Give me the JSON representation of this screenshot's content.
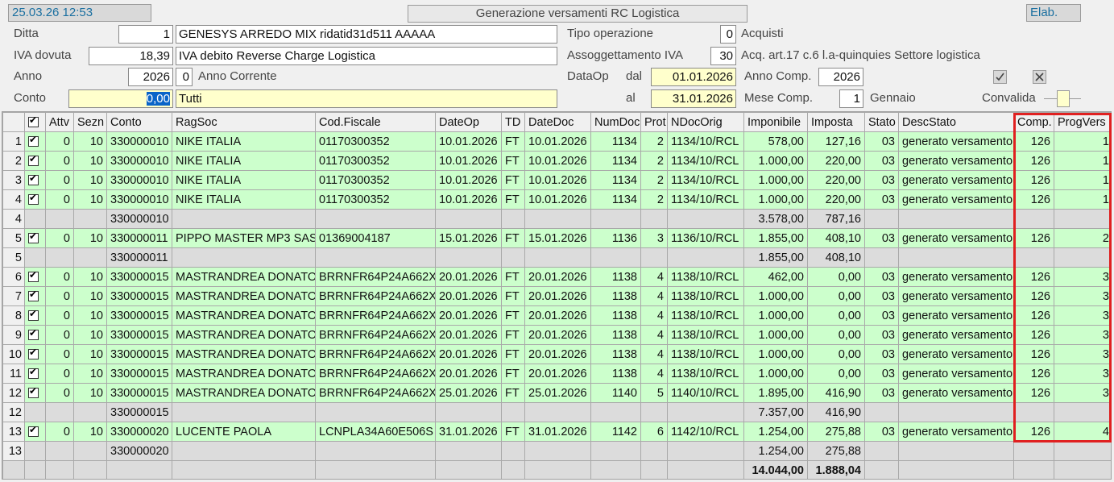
{
  "header": {
    "datetime": "25.03.26 12:53",
    "title": "Generazione versamenti RC Logistica",
    "elab_label": "Elab."
  },
  "form": {
    "ditta": {
      "label": "Ditta",
      "code": "1",
      "desc": "GENESYS ARREDO MIX ridatid31d511 AAAAA"
    },
    "iva_dovuta": {
      "label": "IVA dovuta",
      "value": "18,39",
      "desc": "IVA debito Reverse Charge Logistica"
    },
    "anno": {
      "label": "Anno",
      "value": "2026",
      "flag": "0",
      "desc": "Anno Corrente"
    },
    "conto": {
      "label": "Conto",
      "value": "0,00",
      "desc": "Tutti"
    },
    "tipo_operazione": {
      "label": "Tipo operazione",
      "value": "0",
      "desc": "Acquisti"
    },
    "assoggettamento": {
      "label": "Assoggettamento IVA",
      "value": "30",
      "desc": "Acq. art.17 c.6 l.a-quinquies Settore logistica"
    },
    "dataop": {
      "label": "DataOp",
      "dal_label": "dal",
      "dal": "01.01.2026",
      "al_label": "al",
      "al": "31.01.2026"
    },
    "anno_comp": {
      "label": "Anno Comp.",
      "value": "2026"
    },
    "mese_comp": {
      "label": "Mese Comp.",
      "value": "1",
      "desc": "Gennaio"
    },
    "convalida": {
      "label": "Convalida"
    }
  },
  "table": {
    "columns": [
      "Attv",
      "Sezn",
      "Conto",
      "RagSoc",
      "Cod.Fiscale",
      "DateOp",
      "TD",
      "DateDoc",
      "NumDoc",
      "Prot",
      "NDocOrig",
      "Imponibile",
      "Imposta",
      "Stato",
      "DescStato",
      "Comp.",
      "ProgVers"
    ],
    "rows": [
      {
        "type": "data",
        "rn": "1",
        "attv": "0",
        "sezn": "10",
        "conto": "330000010",
        "ragsoc": "NIKE ITALIA",
        "cf": "01170300352",
        "dateop": "10.01.2026",
        "td": "FT",
        "datedoc": "10.01.2026",
        "numdoc": "1134",
        "prot": "2",
        "ndoc": "1134/10/RCL",
        "imp": "578,00",
        "iva": "127,16",
        "stato": "03",
        "desc": "generato versamento",
        "comp": "126",
        "prog": "1"
      },
      {
        "type": "data",
        "rn": "2",
        "attv": "0",
        "sezn": "10",
        "conto": "330000010",
        "ragsoc": "NIKE ITALIA",
        "cf": "01170300352",
        "dateop": "10.01.2026",
        "td": "FT",
        "datedoc": "10.01.2026",
        "numdoc": "1134",
        "prot": "2",
        "ndoc": "1134/10/RCL",
        "imp": "1.000,00",
        "iva": "220,00",
        "stato": "03",
        "desc": "generato versamento",
        "comp": "126",
        "prog": "1"
      },
      {
        "type": "data",
        "rn": "3",
        "attv": "0",
        "sezn": "10",
        "conto": "330000010",
        "ragsoc": "NIKE ITALIA",
        "cf": "01170300352",
        "dateop": "10.01.2026",
        "td": "FT",
        "datedoc": "10.01.2026",
        "numdoc": "1134",
        "prot": "2",
        "ndoc": "1134/10/RCL",
        "imp": "1.000,00",
        "iva": "220,00",
        "stato": "03",
        "desc": "generato versamento",
        "comp": "126",
        "prog": "1"
      },
      {
        "type": "data",
        "rn": "4",
        "attv": "0",
        "sezn": "10",
        "conto": "330000010",
        "ragsoc": "NIKE ITALIA",
        "cf": "01170300352",
        "dateop": "10.01.2026",
        "td": "FT",
        "datedoc": "10.01.2026",
        "numdoc": "1134",
        "prot": "2",
        "ndoc": "1134/10/RCL",
        "imp": "1.000,00",
        "iva": "220,00",
        "stato": "03",
        "desc": "generato versamento",
        "comp": "126",
        "prog": "1"
      },
      {
        "type": "sub",
        "rn": "4",
        "conto": "330000010",
        "imp": "3.578,00",
        "iva": "787,16"
      },
      {
        "type": "data",
        "rn": "5",
        "attv": "0",
        "sezn": "10",
        "conto": "330000011",
        "ragsoc": "PIPPO MASTER MP3 SAS",
        "cf": "01369004187",
        "dateop": "15.01.2026",
        "td": "FT",
        "datedoc": "15.01.2026",
        "numdoc": "1136",
        "prot": "3",
        "ndoc": "1136/10/RCL",
        "imp": "1.855,00",
        "iva": "408,10",
        "stato": "03",
        "desc": "generato versamento",
        "comp": "126",
        "prog": "2"
      },
      {
        "type": "sub",
        "rn": "5",
        "conto": "330000011",
        "imp": "1.855,00",
        "iva": "408,10"
      },
      {
        "type": "data",
        "rn": "6",
        "attv": "0",
        "sezn": "10",
        "conto": "330000015",
        "ragsoc": "MASTRANDREA DONATO",
        "cf": "BRRNFR64P24A662X",
        "dateop": "20.01.2026",
        "td": "FT",
        "datedoc": "20.01.2026",
        "numdoc": "1138",
        "prot": "4",
        "ndoc": "1138/10/RCL",
        "imp": "462,00",
        "iva": "0,00",
        "stato": "03",
        "desc": "generato versamento",
        "comp": "126",
        "prog": "3"
      },
      {
        "type": "data",
        "rn": "7",
        "attv": "0",
        "sezn": "10",
        "conto": "330000015",
        "ragsoc": "MASTRANDREA DONATO",
        "cf": "BRRNFR64P24A662X",
        "dateop": "20.01.2026",
        "td": "FT",
        "datedoc": "20.01.2026",
        "numdoc": "1138",
        "prot": "4",
        "ndoc": "1138/10/RCL",
        "imp": "1.000,00",
        "iva": "0,00",
        "stato": "03",
        "desc": "generato versamento",
        "comp": "126",
        "prog": "3"
      },
      {
        "type": "data",
        "rn": "8",
        "attv": "0",
        "sezn": "10",
        "conto": "330000015",
        "ragsoc": "MASTRANDREA DONATO",
        "cf": "BRRNFR64P24A662X",
        "dateop": "20.01.2026",
        "td": "FT",
        "datedoc": "20.01.2026",
        "numdoc": "1138",
        "prot": "4",
        "ndoc": "1138/10/RCL",
        "imp": "1.000,00",
        "iva": "0,00",
        "stato": "03",
        "desc": "generato versamento",
        "comp": "126",
        "prog": "3"
      },
      {
        "type": "data",
        "rn": "9",
        "attv": "0",
        "sezn": "10",
        "conto": "330000015",
        "ragsoc": "MASTRANDREA DONATO",
        "cf": "BRRNFR64P24A662X",
        "dateop": "20.01.2026",
        "td": "FT",
        "datedoc": "20.01.2026",
        "numdoc": "1138",
        "prot": "4",
        "ndoc": "1138/10/RCL",
        "imp": "1.000,00",
        "iva": "0,00",
        "stato": "03",
        "desc": "generato versamento",
        "comp": "126",
        "prog": "3"
      },
      {
        "type": "data",
        "rn": "10",
        "attv": "0",
        "sezn": "10",
        "conto": "330000015",
        "ragsoc": "MASTRANDREA DONATO",
        "cf": "BRRNFR64P24A662X",
        "dateop": "20.01.2026",
        "td": "FT",
        "datedoc": "20.01.2026",
        "numdoc": "1138",
        "prot": "4",
        "ndoc": "1138/10/RCL",
        "imp": "1.000,00",
        "iva": "0,00",
        "stato": "03",
        "desc": "generato versamento",
        "comp": "126",
        "prog": "3"
      },
      {
        "type": "data",
        "rn": "11",
        "attv": "0",
        "sezn": "10",
        "conto": "330000015",
        "ragsoc": "MASTRANDREA DONATO",
        "cf": "BRRNFR64P24A662X",
        "dateop": "20.01.2026",
        "td": "FT",
        "datedoc": "20.01.2026",
        "numdoc": "1138",
        "prot": "4",
        "ndoc": "1138/10/RCL",
        "imp": "1.000,00",
        "iva": "0,00",
        "stato": "03",
        "desc": "generato versamento",
        "comp": "126",
        "prog": "3"
      },
      {
        "type": "data",
        "rn": "12",
        "attv": "0",
        "sezn": "10",
        "conto": "330000015",
        "ragsoc": "MASTRANDREA DONATO",
        "cf": "BRRNFR64P24A662X",
        "dateop": "25.01.2026",
        "td": "FT",
        "datedoc": "25.01.2026",
        "numdoc": "1140",
        "prot": "5",
        "ndoc": "1140/10/RCL",
        "imp": "1.895,00",
        "iva": "416,90",
        "stato": "03",
        "desc": "generato versamento",
        "comp": "126",
        "prog": "3"
      },
      {
        "type": "sub",
        "rn": "12",
        "conto": "330000015",
        "imp": "7.357,00",
        "iva": "416,90"
      },
      {
        "type": "data",
        "rn": "13",
        "attv": "0",
        "sezn": "10",
        "conto": "330000020",
        "ragsoc": "LUCENTE PAOLA",
        "cf": "LCNPLA34A60E506S",
        "dateop": "31.01.2026",
        "td": "FT",
        "datedoc": "31.01.2026",
        "numdoc": "1142",
        "prot": "6",
        "ndoc": "1142/10/RCL",
        "imp": "1.254,00",
        "iva": "275,88",
        "stato": "03",
        "desc": "generato versamento",
        "comp": "126",
        "prog": "4"
      },
      {
        "type": "sub",
        "rn": "13",
        "conto": "330000020",
        "imp": "1.254,00",
        "iva": "275,88"
      }
    ],
    "totals": {
      "imp": "14.044,00",
      "iva": "1.888,04"
    }
  },
  "colors": {
    "data_row": "#ccffcc",
    "subtotal_row": "#dcdcdc",
    "input_yellow": "#ffffcc",
    "highlight": "#e02020",
    "datetime_text": "#1a6fa0"
  }
}
